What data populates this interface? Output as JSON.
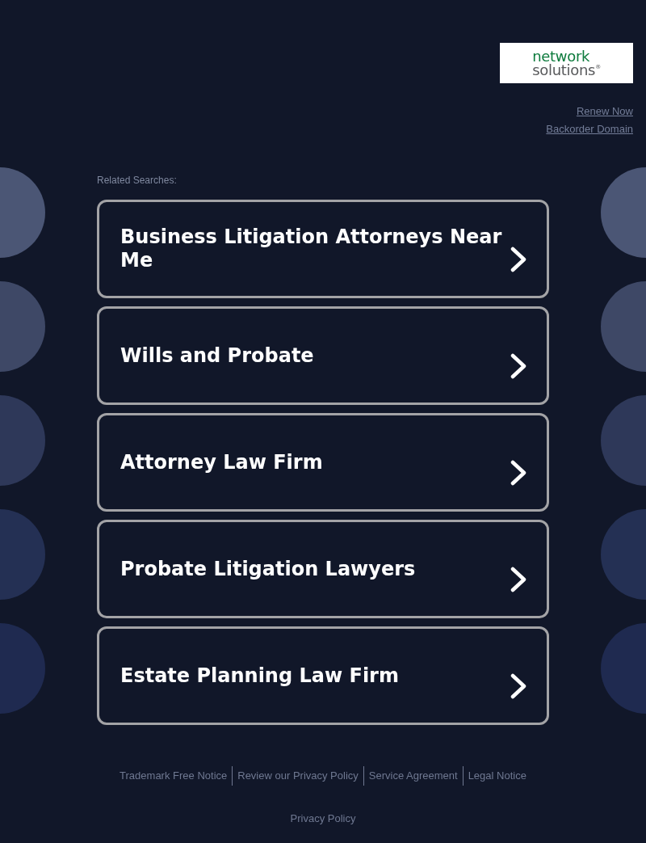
{
  "logo": {
    "top": "network",
    "bottom": "solutions$^{®}$"
  },
  "header_links": [
    "Renew Now",
    "Backorder Domain"
  ],
  "related_searches": {
    "heading": "Related Searches:",
    "items": [
      "Business Litigation Attorneys Near Me",
      "Wills and Probate",
      "Attorney Law Firm",
      "Probate Litigation Lawyers",
      "Estate Planning Law Firm"
    ]
  },
  "footer": {
    "links": [
      "Trademark Free Notice",
      "Review our Privacy Policy",
      "Service Agreement",
      "Legal Notice"
    ],
    "bottom_link": "Privacy Policy"
  }
}
